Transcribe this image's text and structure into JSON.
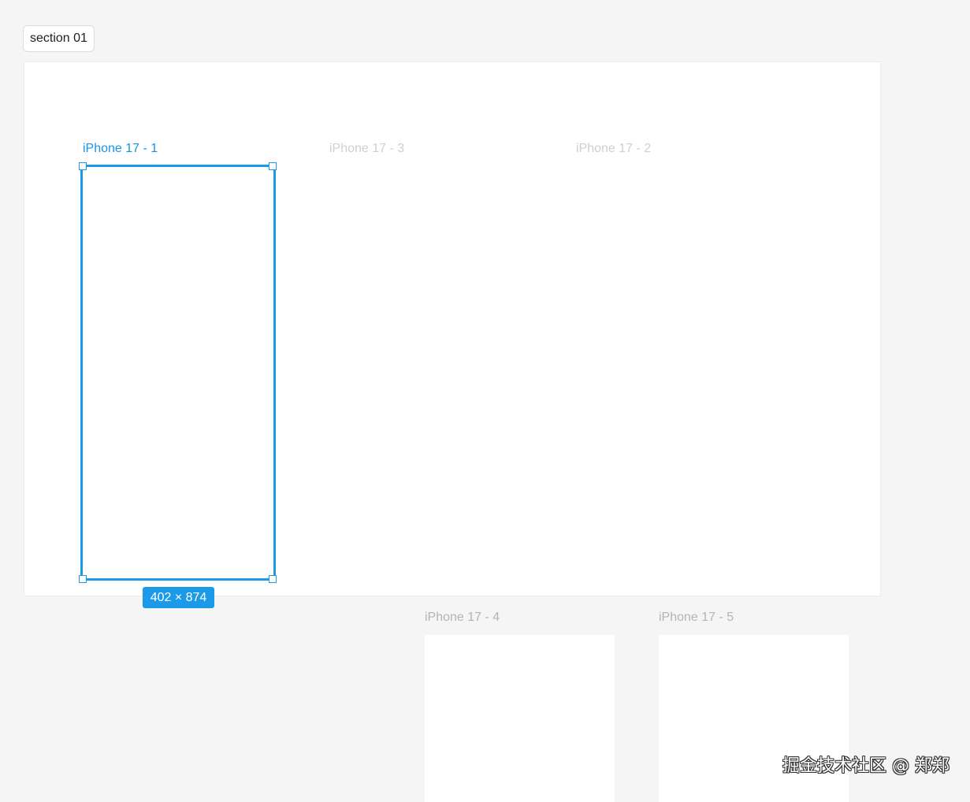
{
  "section": {
    "label": "section 01"
  },
  "frames": {
    "iphone1": {
      "label": "iPhone 17 - 1"
    },
    "iphone3": {
      "label": "iPhone 17 - 3"
    },
    "iphone2": {
      "label": "iPhone 17 - 2"
    },
    "iphone4": {
      "label": "iPhone 17 - 4"
    },
    "iphone5": {
      "label": "iPhone 17 - 5"
    }
  },
  "selection": {
    "size": "402 × 874"
  },
  "watermark": {
    "text": "掘金技术社区 @ 郑郑"
  },
  "colors": {
    "canvas": "#f5f5f5",
    "selection": "#1a9ae8",
    "frame": "#ffffff"
  }
}
